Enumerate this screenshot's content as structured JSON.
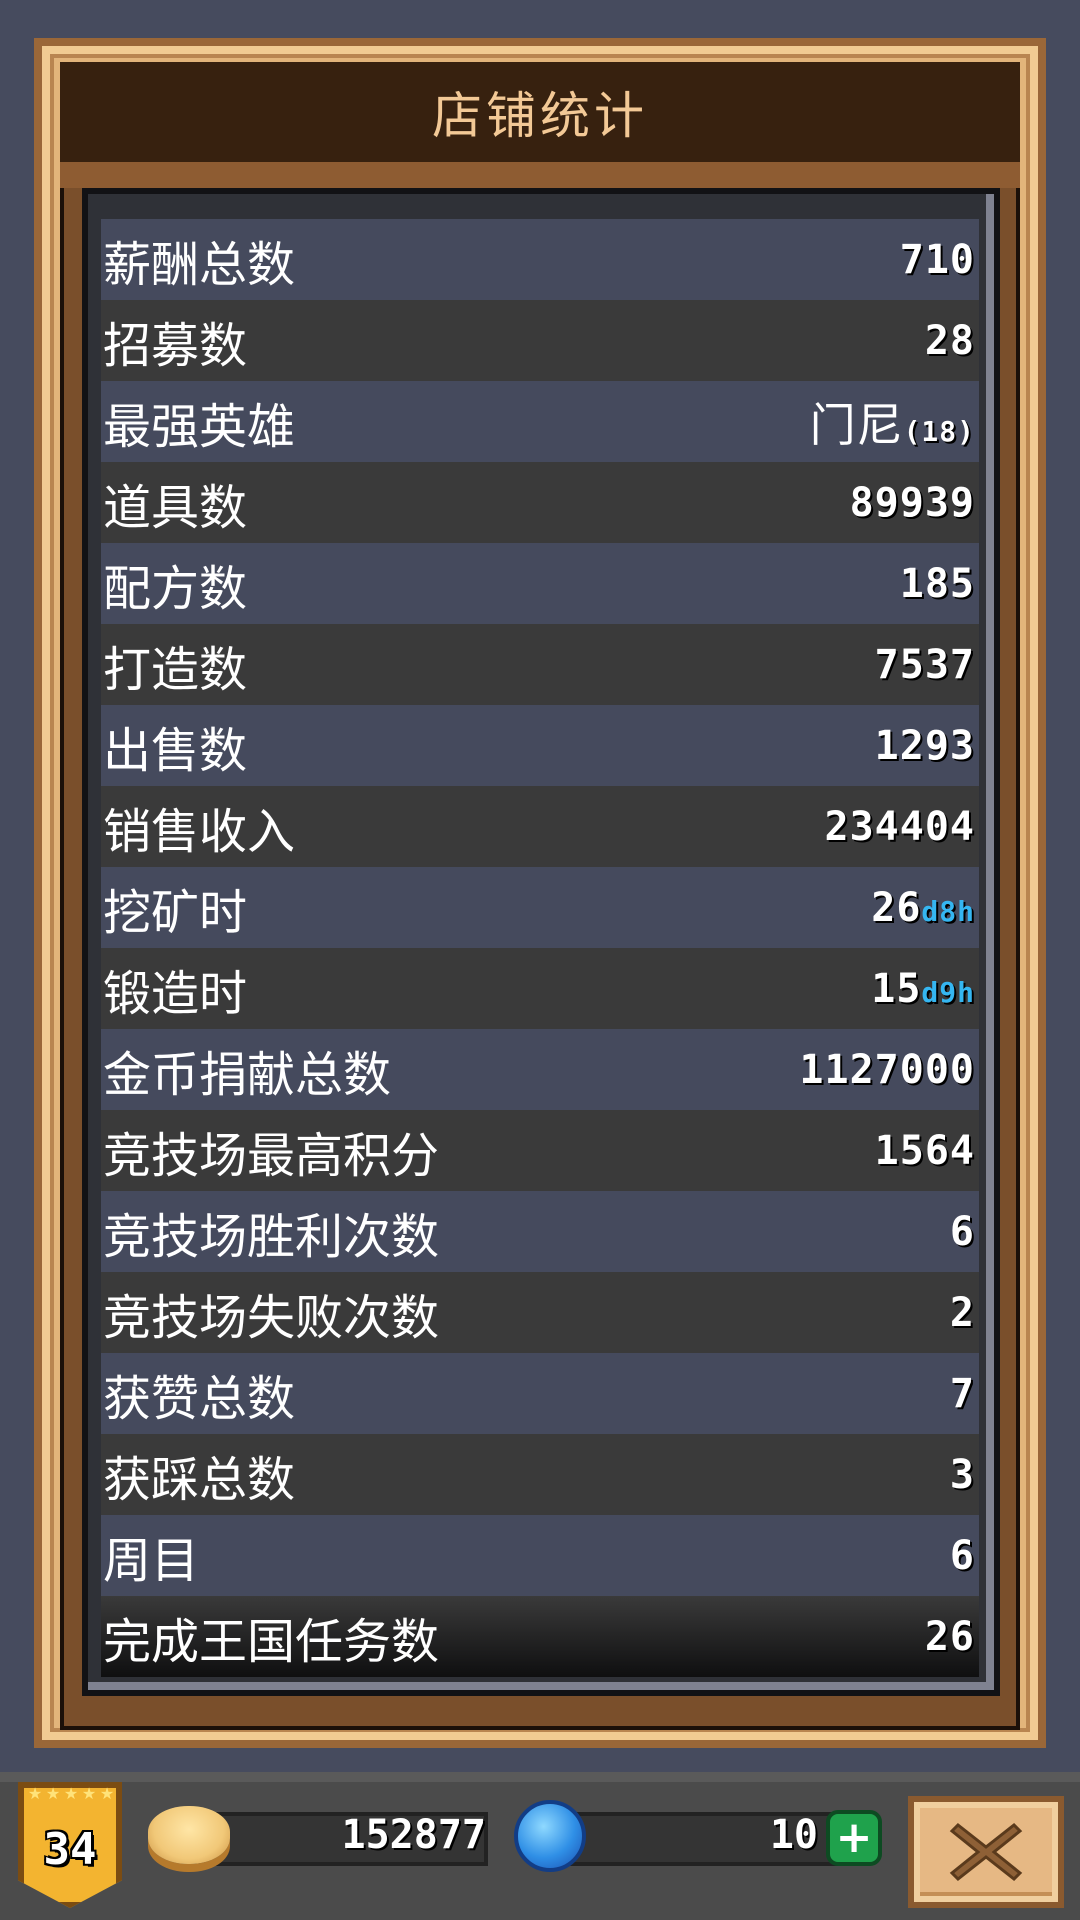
{
  "dialog": {
    "title": "店铺统计"
  },
  "stats": [
    {
      "label": "薪酬总数",
      "value": "710"
    },
    {
      "label": "招募数",
      "value": "28"
    },
    {
      "label": "最强英雄",
      "value_name": "门尼",
      "value_level": "(18)"
    },
    {
      "label": "道具数",
      "value": "89939"
    },
    {
      "label": "配方数",
      "value": "185"
    },
    {
      "label": "打造数",
      "value": "7537"
    },
    {
      "label": "出售数",
      "value": "1293"
    },
    {
      "label": "销售收入",
      "value": "234404"
    },
    {
      "label": "挖矿时",
      "value_main": "26",
      "value_d": "d",
      "value_extra": "8",
      "value_h": "h"
    },
    {
      "label": "锻造时",
      "value_main": "15",
      "value_d": "d",
      "value_extra": "9",
      "value_h": "h"
    },
    {
      "label": "金币捐献总数",
      "value": "1127000"
    },
    {
      "label": "竞技场最高积分",
      "value": "1564"
    },
    {
      "label": "竞技场胜利次数",
      "value": "6"
    },
    {
      "label": "竞技场失败次数",
      "value": "2"
    },
    {
      "label": "获赞总数",
      "value": "7"
    },
    {
      "label": "获踩总数",
      "value": "3"
    },
    {
      "label": "周目",
      "value": "6"
    },
    {
      "label": "完成王国任务数",
      "value": "26"
    }
  ],
  "footer": {
    "level": "34",
    "level_stars": 5,
    "gold": "152877",
    "gems": "10",
    "add_icon": "plus-icon",
    "close_icon": "close-icon"
  },
  "colors": {
    "row_odd": "#454a5d",
    "row_even": "#3a3a3a",
    "title_bg": "#37210f",
    "title_text": "#f3c996",
    "frame": "#e3b57b",
    "time_unit": "#35b6f1",
    "add_button": "#1fa24c"
  }
}
